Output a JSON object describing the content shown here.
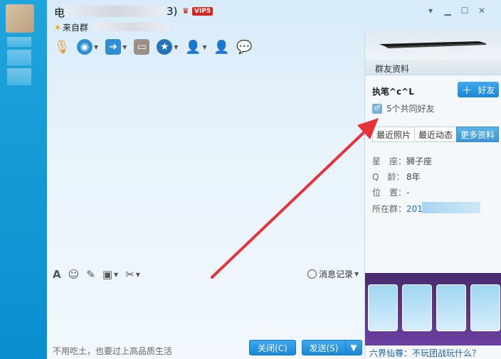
{
  "window": {
    "title_prefix": "电",
    "title_suffix": "3)",
    "vip_label": "VIP5",
    "source_label": "来自群"
  },
  "input_toolbar": {
    "message_record_label": "消息记录"
  },
  "bottom": {
    "ad_text": "不用吃土，也要过上高品质生活",
    "close_label": "关闭(C)",
    "send_label": "发送(S)"
  },
  "side_panel": {
    "header": "群友资料",
    "nickname": "执笔^c^L",
    "add_friend_label": "好友",
    "common_friends": "5个共同好友",
    "tabs": [
      "最近照片",
      "最近动态",
      "更多资料"
    ],
    "info": [
      {
        "key": "星　座：",
        "value": "狮子座"
      },
      {
        "key": "Q　龄：",
        "value": "8年"
      },
      {
        "key": "位　置：",
        "value": "-"
      },
      {
        "key": "所在群：",
        "value": "201"
      }
    ],
    "game_caption": "六界仙尊：不玩团战玩什么？"
  },
  "colors": {
    "accent": "#1b86d6",
    "arrow": "#e8323a"
  }
}
